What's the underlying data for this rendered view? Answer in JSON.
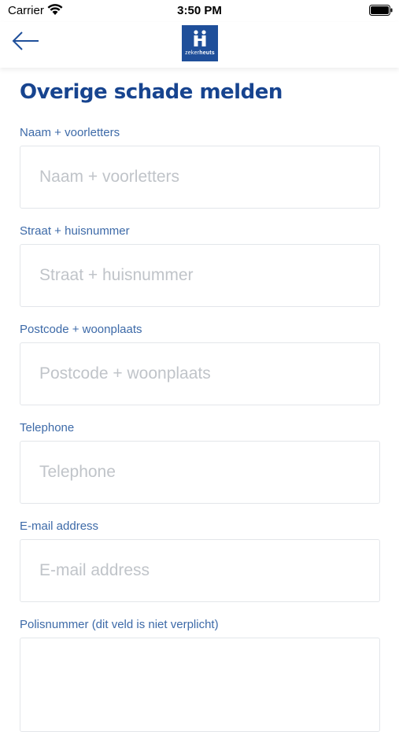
{
  "status_bar": {
    "carrier": "Carrier",
    "time": "3:50 PM",
    "wifi_icon": "wifi-icon",
    "battery_icon": "battery-icon"
  },
  "nav": {
    "back_icon": "arrow-left-icon",
    "logo": {
      "text_light": "zeker",
      "text_bold": "heuts",
      "color": "#1f4f9a"
    }
  },
  "page": {
    "title": "Overige schade melden",
    "title_color": "#17448f",
    "label_color": "#3d6aa8"
  },
  "form": {
    "fields": [
      {
        "label": "Naam + voorletters",
        "placeholder": "Naam + voorletters",
        "value": ""
      },
      {
        "label": "Straat + huisnummer",
        "placeholder": "Straat + huisnummer",
        "value": ""
      },
      {
        "label": "Postcode + woonplaats",
        "placeholder": "Postcode + woonplaats",
        "value": ""
      },
      {
        "label": "Telephone",
        "placeholder": "Telephone",
        "value": ""
      },
      {
        "label": "E-mail address",
        "placeholder": "E-mail address",
        "value": ""
      },
      {
        "label": "Polisnummer (dit veld is niet verplicht)",
        "placeholder": "",
        "value": ""
      }
    ]
  }
}
